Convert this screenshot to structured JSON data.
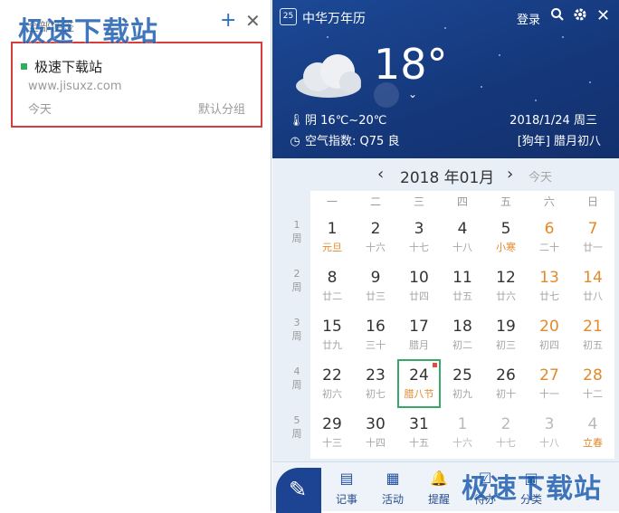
{
  "watermark": "极速下载站",
  "left_panel": {
    "title": "全部便签",
    "add_label": "+",
    "close_label": "✕",
    "note": {
      "title": "极速下载站",
      "url": "www.jisuxz.com",
      "date": "今天",
      "group": "默认分组"
    }
  },
  "right_panel": {
    "app_icon_text": "25",
    "app_title": "中华万年历",
    "login": "登录",
    "icons": [
      "search-icon",
      "gear-icon",
      "close-icon"
    ],
    "weather": {
      "temperature": "18°",
      "condition": "阴",
      "temp_range": "16℃~20℃",
      "aqi_label": "空气指数:",
      "aqi_value": "Q75",
      "aqi_level": "良",
      "date": "2018/1/24",
      "weekday": "周三",
      "lunar": "[狗年] 腊月初八"
    },
    "colors": {
      "header_bg": "#1c4996",
      "weekend": "#e2892a",
      "today_border": "#35a86a"
    }
  },
  "calendar": {
    "prev": "‹",
    "month_label": "2018 年01月",
    "next": "›",
    "today_button": "今天",
    "weekdays": [
      "一",
      "二",
      "三",
      "四",
      "五",
      "六",
      "日"
    ],
    "week_label": "周",
    "weeks": [
      {
        "num": "1",
        "days": [
          {
            "d": "1",
            "l": "元旦",
            "fest": true
          },
          {
            "d": "2",
            "l": "十六"
          },
          {
            "d": "3",
            "l": "十七"
          },
          {
            "d": "4",
            "l": "十八"
          },
          {
            "d": "5",
            "l": "小寒",
            "fest": true
          },
          {
            "d": "6",
            "l": "二十",
            "wk": true
          },
          {
            "d": "7",
            "l": "廿一",
            "wk": true
          }
        ]
      },
      {
        "num": "2",
        "days": [
          {
            "d": "8",
            "l": "廿二"
          },
          {
            "d": "9",
            "l": "廿三"
          },
          {
            "d": "10",
            "l": "廿四"
          },
          {
            "d": "11",
            "l": "廿五"
          },
          {
            "d": "12",
            "l": "廿六"
          },
          {
            "d": "13",
            "l": "廿七",
            "wk": true
          },
          {
            "d": "14",
            "l": "廿八",
            "wk": true
          }
        ]
      },
      {
        "num": "3",
        "days": [
          {
            "d": "15",
            "l": "廿九"
          },
          {
            "d": "16",
            "l": "三十"
          },
          {
            "d": "17",
            "l": "腊月"
          },
          {
            "d": "18",
            "l": "初二"
          },
          {
            "d": "19",
            "l": "初三"
          },
          {
            "d": "20",
            "l": "初四",
            "wk": true
          },
          {
            "d": "21",
            "l": "初五",
            "wk": true
          }
        ]
      },
      {
        "num": "4",
        "days": [
          {
            "d": "22",
            "l": "初六"
          },
          {
            "d": "23",
            "l": "初七"
          },
          {
            "d": "24",
            "l": "腊八节",
            "today": true
          },
          {
            "d": "25",
            "l": "初九"
          },
          {
            "d": "26",
            "l": "初十"
          },
          {
            "d": "27",
            "l": "十一",
            "wk": true
          },
          {
            "d": "28",
            "l": "十二",
            "wk": true
          }
        ]
      },
      {
        "num": "5",
        "days": [
          {
            "d": "29",
            "l": "十三"
          },
          {
            "d": "30",
            "l": "十四"
          },
          {
            "d": "31",
            "l": "十五"
          },
          {
            "d": "1",
            "l": "十六",
            "other": true
          },
          {
            "d": "2",
            "l": "十七",
            "other": true
          },
          {
            "d": "3",
            "l": "十八",
            "other": true
          },
          {
            "d": "4",
            "l": "立春",
            "other": true,
            "fest": true
          }
        ]
      }
    ]
  },
  "toolbar": {
    "items": [
      {
        "label": "记事",
        "icon": "notebook-icon"
      },
      {
        "label": "活动",
        "icon": "calendar-icon"
      },
      {
        "label": "提醒",
        "icon": "bell-icon"
      },
      {
        "label": "待办",
        "icon": "todo-icon"
      },
      {
        "label": "分类",
        "icon": "category-icon"
      }
    ]
  }
}
